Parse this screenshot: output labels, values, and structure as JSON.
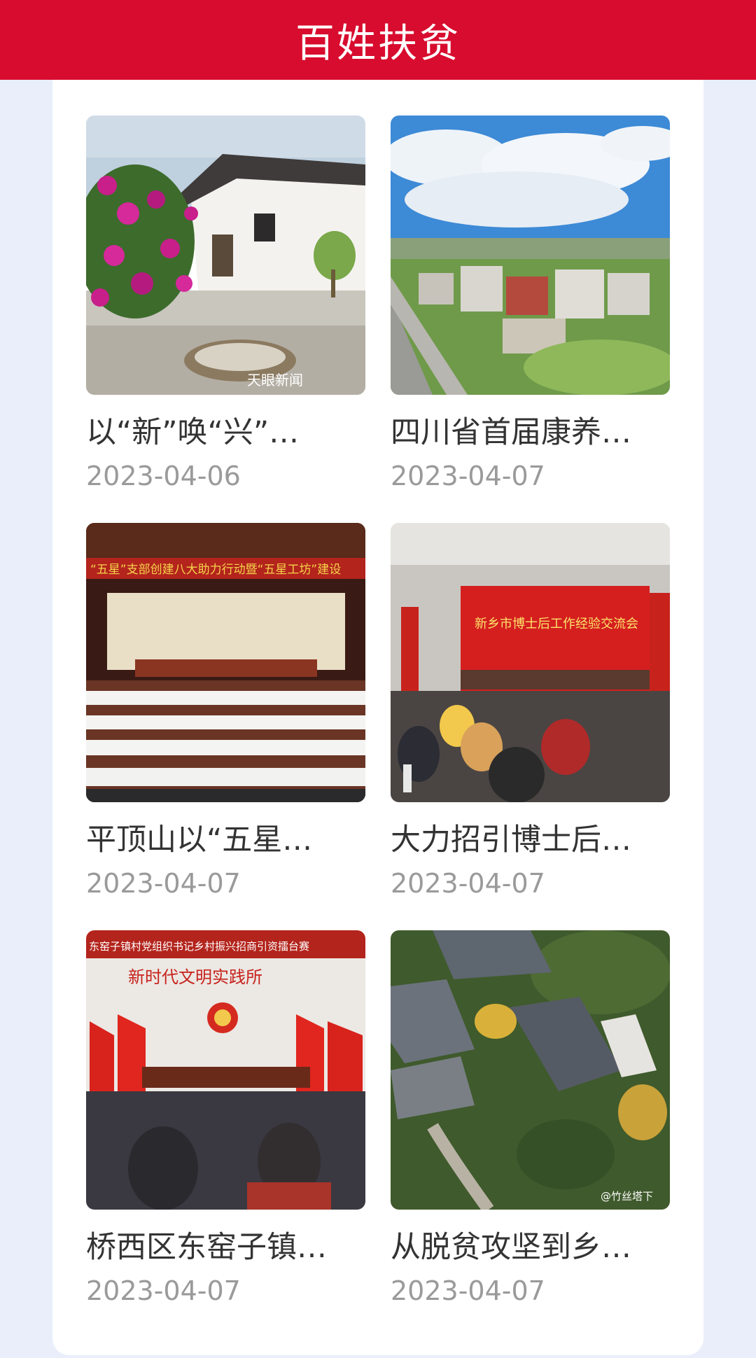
{
  "header": {
    "title": "百姓扶贫"
  },
  "articles": [
    {
      "title": "以“新”唤“兴”…",
      "date": "2023-04-06",
      "image": "village-house-flowers"
    },
    {
      "title": "四川省首届康养…",
      "date": "2023-04-07",
      "image": "aerial-campus-buildings"
    },
    {
      "title": "平顶山以“五星…",
      "date": "2023-04-07",
      "image": "conference-hall-meeting"
    },
    {
      "title": "大力招引博士后…",
      "date": "2023-04-07",
      "image": "postdoc-exchange-meeting"
    },
    {
      "title": "桥西区东窑子镇…",
      "date": "2023-04-07",
      "image": "party-meeting-flags"
    },
    {
      "title": "从脱贫攻坚到乡…",
      "date": "2023-04-07",
      "image": "aerial-rural-rooftops"
    }
  ]
}
